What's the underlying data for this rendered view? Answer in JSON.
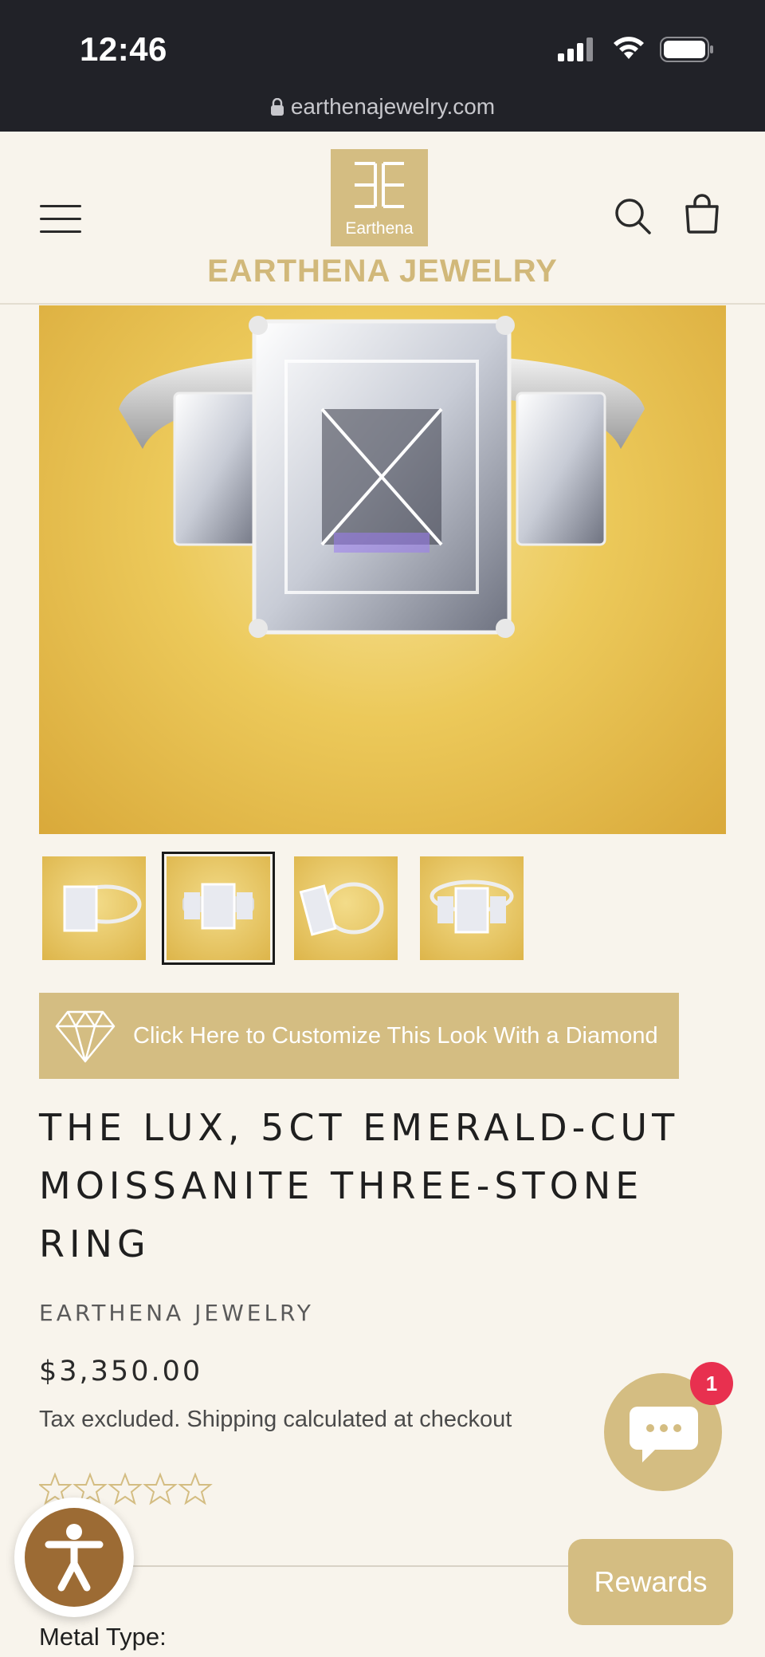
{
  "status_bar": {
    "time": "12:46",
    "url": "earthenajewelry.com"
  },
  "header": {
    "logo_small": "Earthena",
    "logo_name": "EARTHENA JEWELRY"
  },
  "customize": {
    "label": "Click Here to Customize This Look With a Diamond"
  },
  "product": {
    "title_lines": [
      "THE LUX, 5CT EMERALD-CUT",
      "MOISSANITE THREE-STONE",
      "RING"
    ],
    "vendor": "EARTHENA JEWELRY",
    "price": "$3,350.00",
    "tax_note": "Tax excluded. Shipping calculated at checkout",
    "rating": 0,
    "rating_max": 5,
    "option_label": "Metal Type:"
  },
  "thumbnails": {
    "count": 4,
    "selected_index": 1
  },
  "chat": {
    "badge": "1"
  },
  "rewards": {
    "label": "Rewards"
  },
  "colors": {
    "brand_gold": "#d4bd82",
    "logo_text": "#d1b87a",
    "background": "#f8f4ec",
    "badge_red": "#e8304f",
    "accessibility_brown": "#9c6b34"
  }
}
